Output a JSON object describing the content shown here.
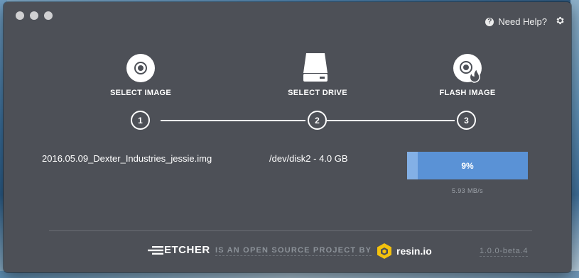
{
  "header": {
    "help_label": "Need Help?",
    "help_icon": "question-circle-icon",
    "settings_icon": "gear-icon"
  },
  "steps": [
    {
      "label": "SELECT IMAGE",
      "number": "1",
      "icon": "disc-icon"
    },
    {
      "label": "SELECT DRIVE",
      "number": "2",
      "icon": "drive-icon"
    },
    {
      "label": "FLASH IMAGE",
      "number": "3",
      "icon": "flash-disc-icon"
    }
  ],
  "selection": {
    "image_name": "2016.05.09_Dexter_Industries_jessie.img",
    "drive": "/dev/disk2 - 4.0 GB"
  },
  "progress": {
    "percent_label": "9%",
    "fraction": 0.09,
    "speed": "5.93 MB/s",
    "color_fill": "#83b0e6",
    "color_track": "#5a92d6"
  },
  "footer": {
    "brand": "ETCHER",
    "tagline": "IS AN OPEN SOURCE PROJECT BY",
    "company": "resin.io",
    "version": "1.0.0-beta.4"
  },
  "colors": {
    "window_bg": "#4d5057",
    "accent": "#5a92d6"
  }
}
